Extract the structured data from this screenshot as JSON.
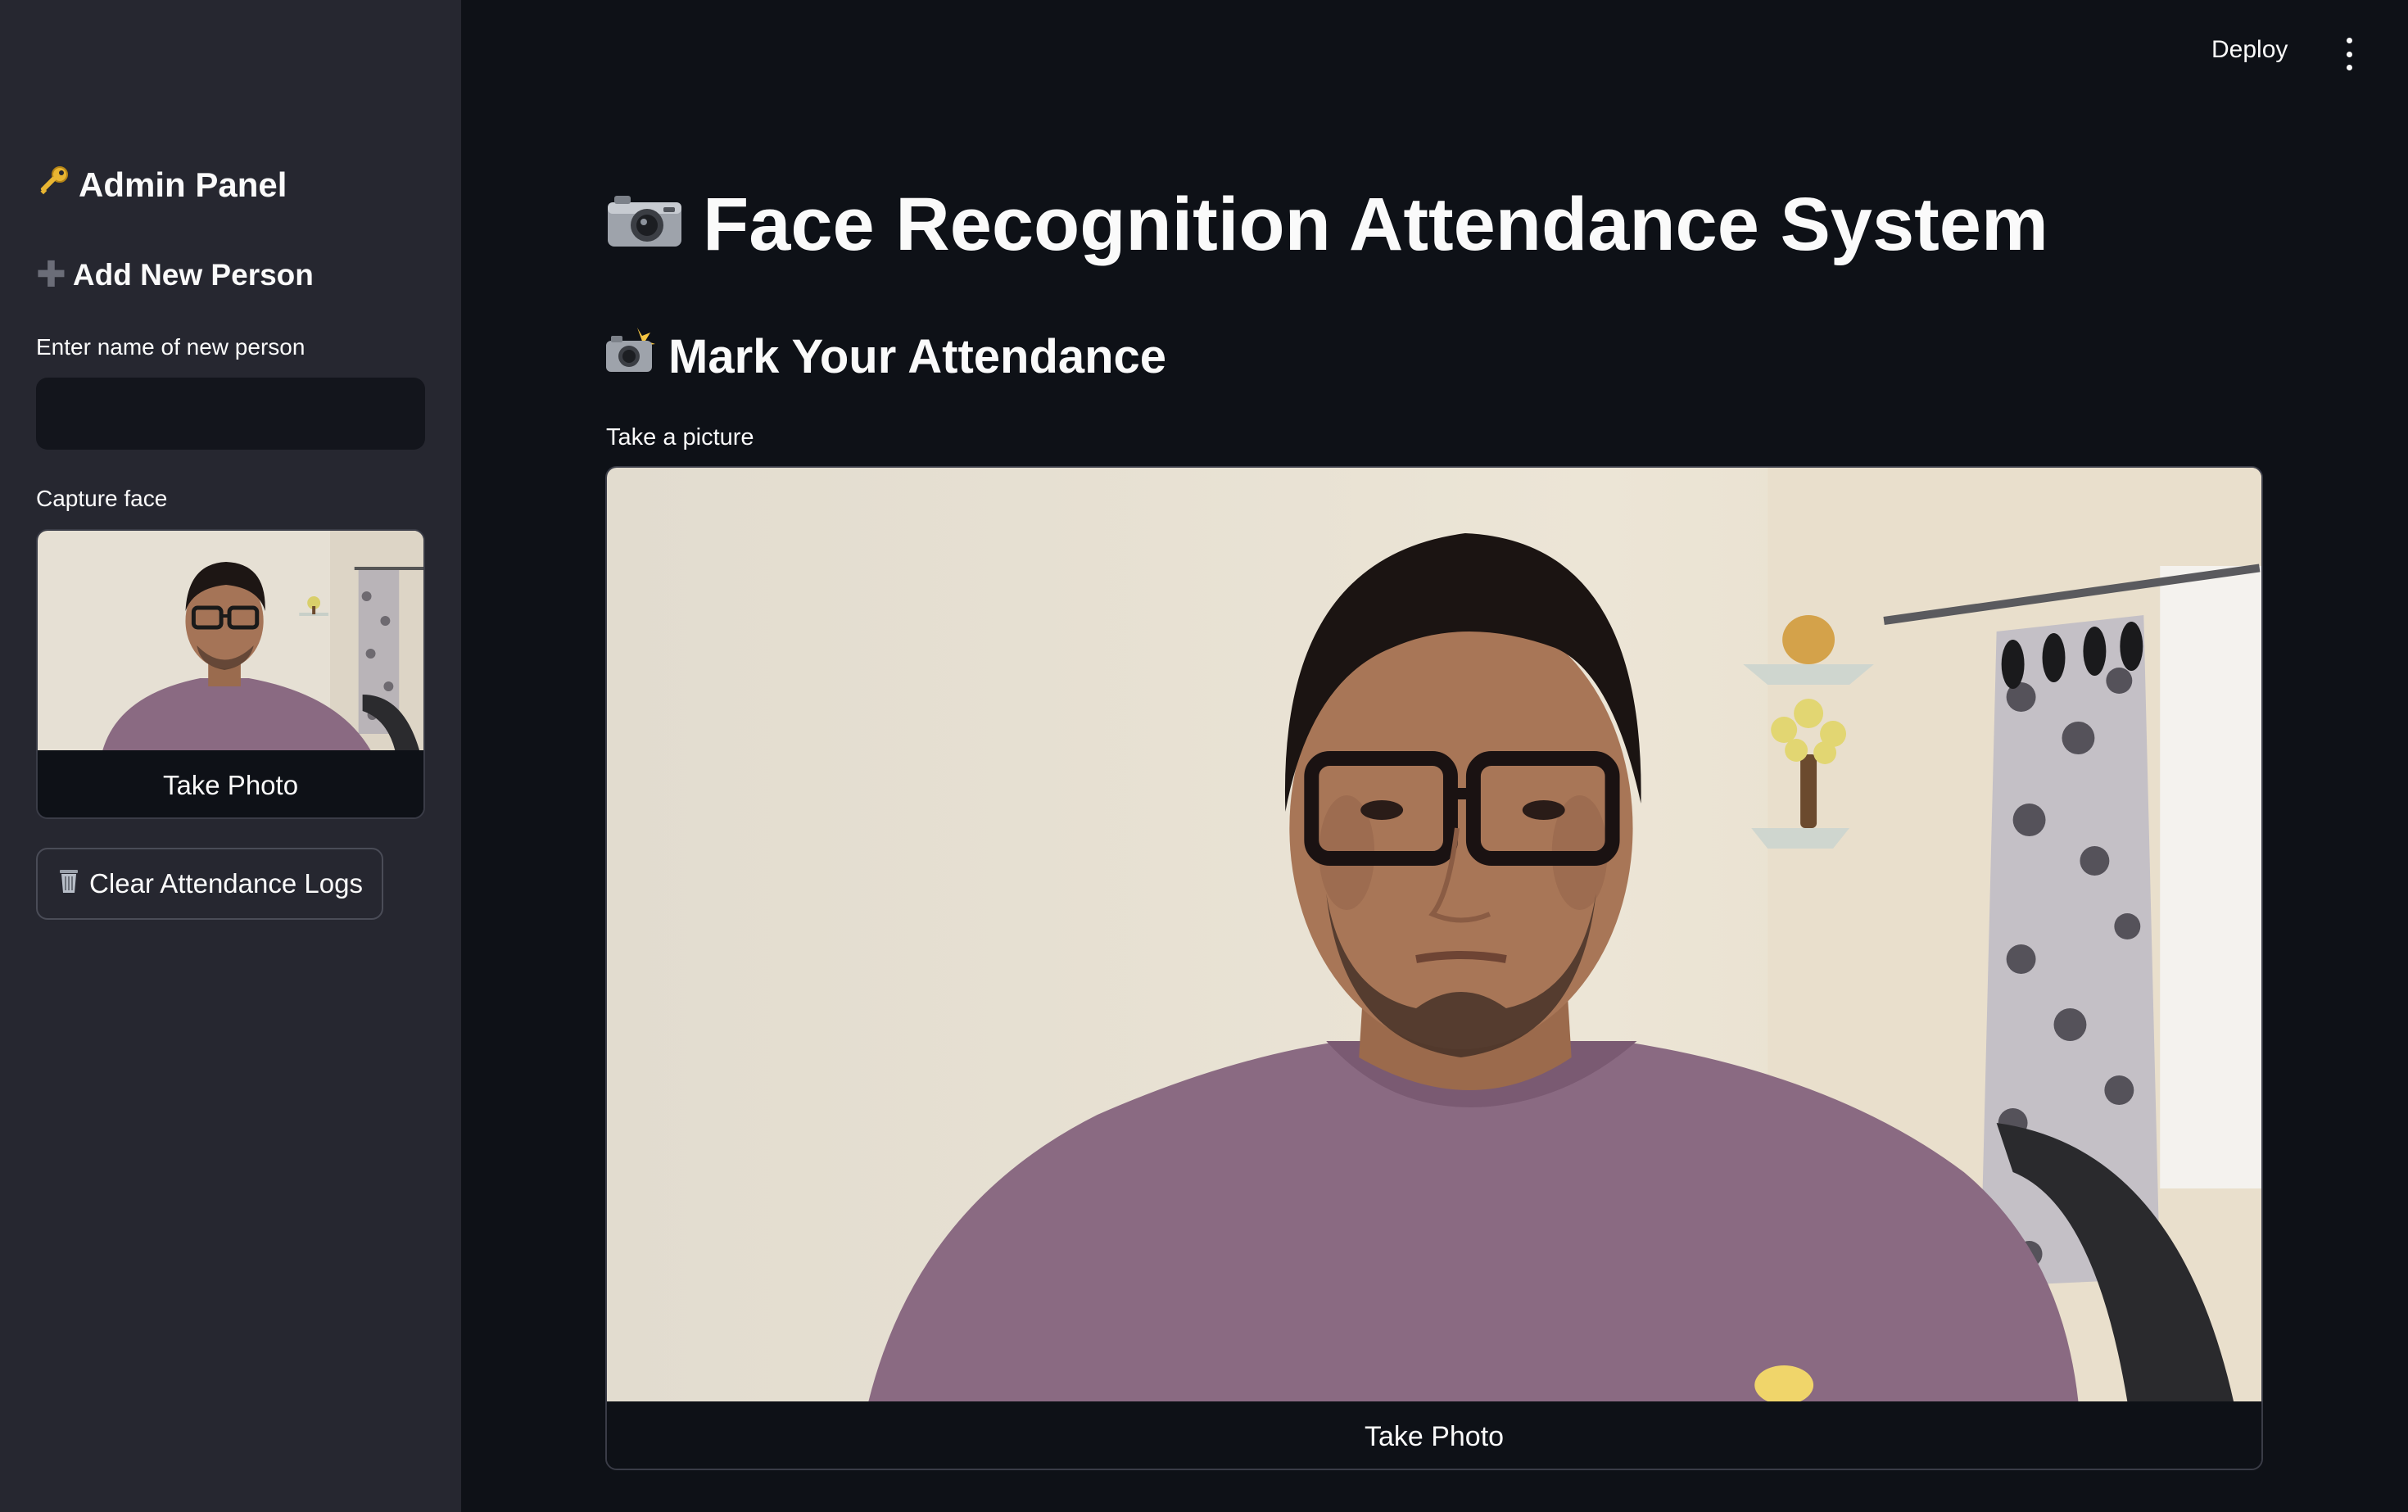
{
  "header": {
    "deploy_label": "Deploy",
    "menu_icon": "kebab-menu-icon"
  },
  "sidebar": {
    "title": "Admin Panel",
    "title_icon": "key-icon",
    "section_title": "Add New Person",
    "section_icon": "plus-icon",
    "name_label": "Enter name of new person",
    "name_value": "",
    "capture_label": "Capture face",
    "capture_button": "Take Photo",
    "clear_button": "Clear Attendance Logs",
    "clear_icon": "trash-icon"
  },
  "main": {
    "title": "Face Recognition Attendance System",
    "title_icon": "camera-icon",
    "section_title": "Mark Your Attendance",
    "section_icon": "camera-flash-icon",
    "picture_label": "Take a picture",
    "take_photo_button": "Take Photo"
  },
  "colors": {
    "background": "#0e1117",
    "sidebar": "#262730",
    "text": "#fafafa",
    "shirt": "#8a6a82",
    "wall": "#e8e2d6"
  }
}
